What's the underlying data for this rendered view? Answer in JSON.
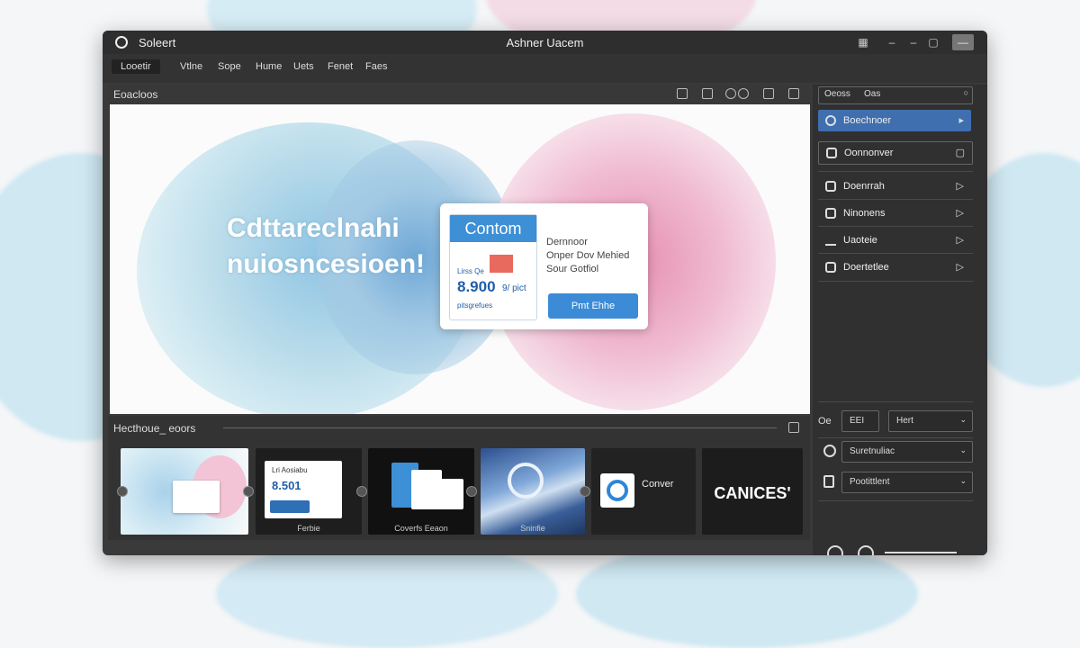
{
  "window": {
    "app_name": "Soleert",
    "title": "Ashner Uacem",
    "controls": [
      "save-icon",
      "minimize-icon",
      "maximize-icon",
      "close-icon"
    ]
  },
  "menubar": {
    "items": [
      "Looetir",
      "Vtlne",
      "Sope",
      "Hume",
      "Uets",
      "Fenet",
      "Faes"
    ]
  },
  "editor": {
    "label": "Eoacloos",
    "canvas": {
      "headline_line1": "Cdttareclnahi",
      "headline_line2": "nuiosncesioen!",
      "card": {
        "inner_title": "Contom",
        "inner_small_top": "Lirss Qe",
        "inner_price": "8.900",
        "inner_price_suffix": "9/ pict",
        "inner_small_bottom": "pitsgrefues",
        "desc_line1": "Dernnoor",
        "desc_line2": "Onper Dov Mehied",
        "desc_line3": "Sour Gotfiol",
        "cta": "Pmt Ehhe"
      }
    }
  },
  "filmstrip": {
    "label": "Hecthoue_ eoors",
    "thumbs": [
      {
        "caption": ""
      },
      {
        "caption": "Ferbie",
        "title": "Lri Aosiabu",
        "price": "8.501"
      },
      {
        "caption": "Coverfs Eeaon"
      },
      {
        "caption": "Sninfie"
      },
      {
        "caption": "",
        "title": "Conver"
      },
      {
        "caption": "",
        "title": "CANICES'"
      }
    ]
  },
  "right_panel": {
    "tabs": [
      "Oeoss",
      "Oas"
    ],
    "items": [
      {
        "label": "Boechnoer",
        "selected": true
      },
      {
        "label": "Oonnonver",
        "boxed": true
      },
      {
        "label": "Doenrrah"
      },
      {
        "label": "Ninonens"
      },
      {
        "label": "Uaoteie"
      },
      {
        "label": "Doertetlee"
      }
    ],
    "row1_label": "Oe",
    "row1_box": "EEI",
    "row1_dropdown": "Hert",
    "dropdown2": "Suretnuliac",
    "dropdown3": "Pootittlent"
  },
  "colors": {
    "accent": "#3f6fae",
    "cta_blue": "#3b8bd6",
    "window_bg": "#3a3a3a"
  }
}
